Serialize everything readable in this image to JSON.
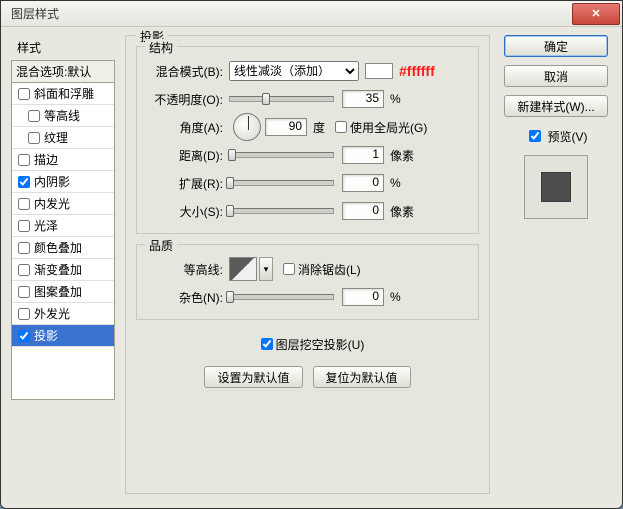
{
  "window": {
    "title": "图层样式"
  },
  "left": {
    "header": "样式",
    "blend_label": "混合选项:默认",
    "items": [
      {
        "label": "斜面和浮雕",
        "checked": false,
        "indent": 0
      },
      {
        "label": "等高线",
        "checked": false,
        "indent": 1
      },
      {
        "label": "纹理",
        "checked": false,
        "indent": 1
      },
      {
        "label": "描边",
        "checked": false,
        "indent": 0
      },
      {
        "label": "内阴影",
        "checked": true,
        "indent": 0
      },
      {
        "label": "内发光",
        "checked": false,
        "indent": 0
      },
      {
        "label": "光泽",
        "checked": false,
        "indent": 0
      },
      {
        "label": "颜色叠加",
        "checked": false,
        "indent": 0
      },
      {
        "label": "渐变叠加",
        "checked": false,
        "indent": 0
      },
      {
        "label": "图案叠加",
        "checked": false,
        "indent": 0
      },
      {
        "label": "外发光",
        "checked": false,
        "indent": 0
      },
      {
        "label": "投影",
        "checked": true,
        "indent": 0,
        "selected": true
      }
    ]
  },
  "panel": {
    "title": "投影",
    "structure": {
      "legend": "结构",
      "blend_mode_label": "混合模式(B):",
      "blend_mode_value": "线性减淡（添加）",
      "color_hash": "#ffffff",
      "opacity_label": "不透明度(O):",
      "opacity_value": "35",
      "opacity_unit": "%",
      "angle_label": "角度(A):",
      "angle_value": "90",
      "angle_unit": "度",
      "global_light_label": "使用全局光(G)",
      "global_light_checked": false,
      "distance_label": "距离(D):",
      "distance_value": "1",
      "distance_unit": "像素",
      "spread_label": "扩展(R):",
      "spread_value": "0",
      "spread_unit": "%",
      "size_label": "大小(S):",
      "size_value": "0",
      "size_unit": "像素"
    },
    "quality": {
      "legend": "品质",
      "contour_label": "等高线:",
      "antialias_label": "消除锯齿(L)",
      "antialias_checked": false,
      "noise_label": "杂色(N):",
      "noise_value": "0",
      "noise_unit": "%"
    },
    "knockout_label": "图层挖空投影(U)",
    "knockout_checked": true,
    "set_default_label": "设置为默认值",
    "reset_default_label": "复位为默认值"
  },
  "right": {
    "ok": "确定",
    "cancel": "取消",
    "new_style": "新建样式(W)...",
    "preview_label": "预览(V)",
    "preview_checked": true
  }
}
